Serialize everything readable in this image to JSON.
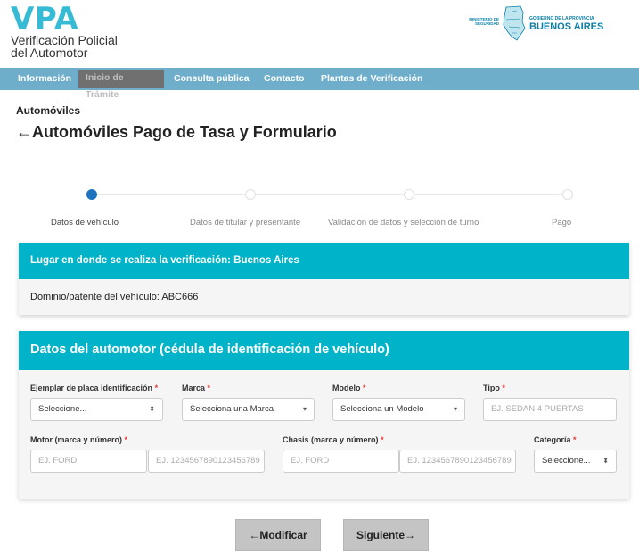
{
  "header": {
    "logo_title": "VPA",
    "logo_line1": "Verificación Policial",
    "logo_line2": "del Automotor",
    "ministerio_line1": "MINISTERIO DE",
    "ministerio_line2": "SEGURIDAD",
    "gobierno": "GOBIERNO DE LA PROVINCIA",
    "provincia": "BUENOS AIRES"
  },
  "nav": {
    "items": [
      "Información",
      "Inicio de Trámite",
      "Consulta pública",
      "Contacto",
      "Plantas de Verificación"
    ]
  },
  "breadcrumb": "Automóviles",
  "title": "←Automóviles Pago de Tasa y Formulario",
  "stepper": {
    "current_step": 1,
    "steps": [
      "Datos de vehículo",
      "Datos de titular y presentante",
      "Validación de datos y selección de turno",
      "Pago"
    ]
  },
  "location_card": {
    "header": "Lugar en donde se realiza la verificación: Buenos Aires",
    "body": "Dominio/patente del vehículo: ABC666"
  },
  "form": {
    "header": "Datos del automotor (cédula de identificación de vehículo)",
    "required_mark": "*",
    "ejemplar": {
      "label": "Ejemplar de placa identificación",
      "value": "Seleccione..."
    },
    "marca": {
      "label": "Marca",
      "value": "Selecciona una Marca"
    },
    "modelo": {
      "label": "Modelo",
      "value": "Selecciona un Modelo"
    },
    "tipo": {
      "label": "Tipo",
      "placeholder": "EJ. SEDAN 4 PUERTAS"
    },
    "motor": {
      "label": "Motor (marca y número)",
      "placeholder_marca": "EJ. FORD",
      "placeholder_numero": "EJ. 1234567890123456789"
    },
    "chasis": {
      "label": "Chasis (marca y número)",
      "placeholder_marca": "EJ. FORD",
      "placeholder_numero": "EJ. 1234567890123456789"
    },
    "categoria": {
      "label": "Categoría",
      "value": "Seleccione..."
    }
  },
  "buttons": {
    "modificar": "←Modificar",
    "siguiente": "Siguiente→"
  },
  "icons": {
    "updown": "⬍",
    "caret": "▾"
  },
  "colors": {
    "accent": "#00b3c8",
    "nav": "#6faecb",
    "step_active": "#1e73be"
  }
}
